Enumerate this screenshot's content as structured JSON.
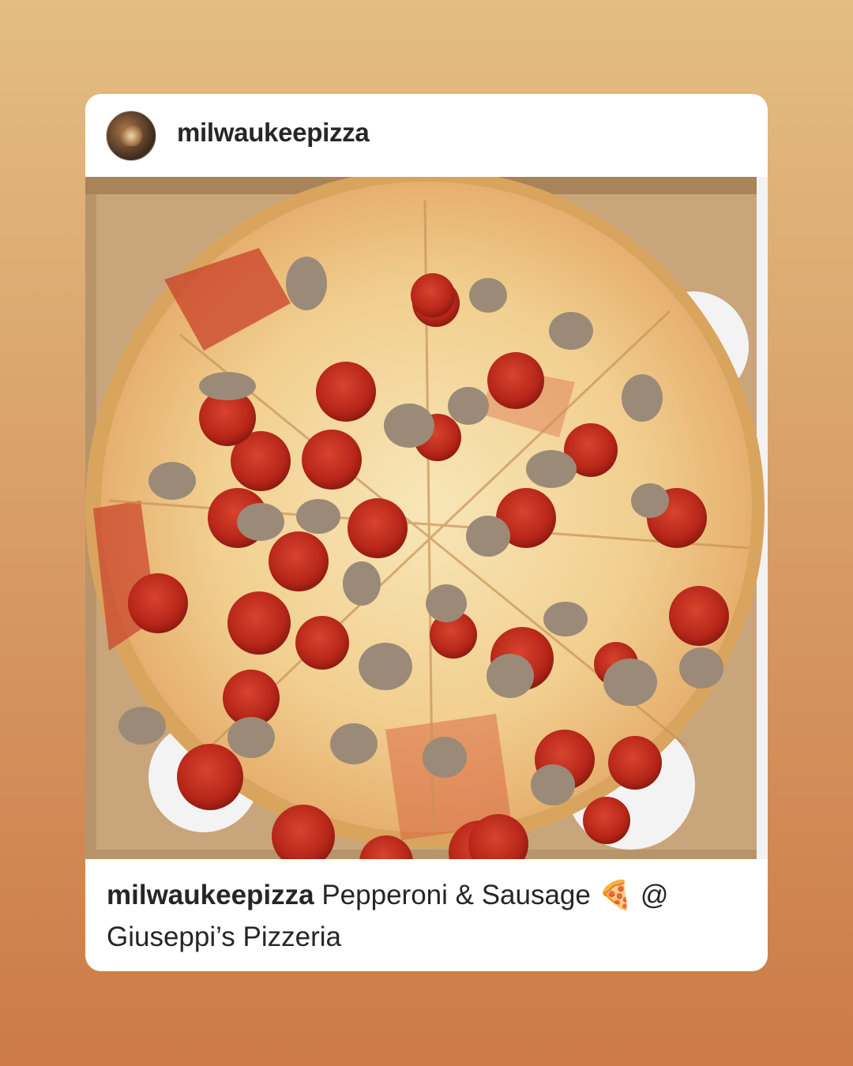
{
  "post": {
    "username": "milwaukeepizza",
    "caption_user": "milwaukeepizza",
    "caption_text": " Pepperoni & Sausage 🍕 @ Giuseppi’s Pizzeria",
    "image_alt": "Pepperoni and sausage pizza in a cardboard box"
  },
  "icons": {
    "avatar": "profile-avatar"
  },
  "colors": {
    "bg_top": "#e3bd82",
    "bg_bottom": "#cc7a47",
    "card": "#ffffff",
    "text": "#262626"
  }
}
